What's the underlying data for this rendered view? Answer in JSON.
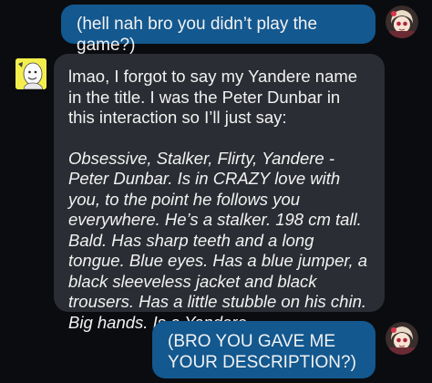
{
  "messages": [
    {
      "sender": "user",
      "text": "(hell nah bro you didn’t play the game?)",
      "avatar_icon": "user-avatar-icon"
    },
    {
      "sender": "bot",
      "avatar_icon": "bot-avatar-icon",
      "intro": "lmao, I forgot to say my Yandere name in the title. I was the Peter Dunbar in this interaction so I’ll just say:",
      "description": "Obsessive, Stalker, Flirty, Yandere - Peter Dunbar. Is in CRAZY love with you, to the point he follows you everywhere. He’s a stalker. 198 cm tall. Bald. Has sharp teeth and a long tongue. Blue eyes. Has a blue jumper, a black sleeveless jacket and black trousers. Has a little stubble on his chin. Big hands. Is a Yandere."
    },
    {
      "sender": "user",
      "text": "(BRO YOU GAVE ME YOUR DESCRIPTION?)",
      "avatar_icon": "user-avatar-icon"
    }
  ],
  "colors": {
    "background": "#0b0c10",
    "user_bubble": "#13588f",
    "bot_bubble": "#2a2d33",
    "text": "#f2f2f2"
  }
}
